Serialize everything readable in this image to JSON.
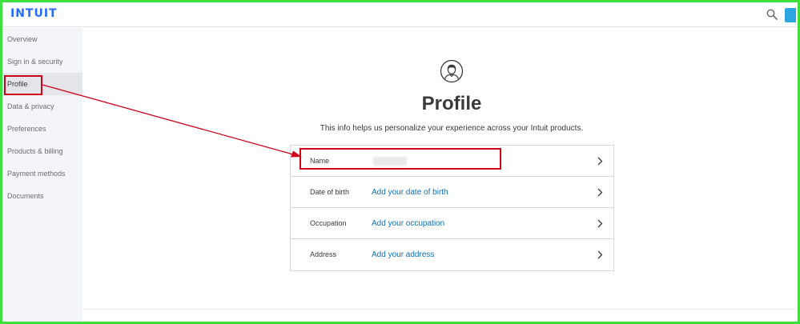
{
  "app": {
    "logo": "INTUIT"
  },
  "header": {
    "search_icon": "search-icon",
    "avatar_icon": "avatar-icon"
  },
  "sidebar": {
    "items": [
      {
        "label": "Overview"
      },
      {
        "label": "Sign in & security"
      },
      {
        "label": "Profile",
        "active": true
      },
      {
        "label": "Data & privacy"
      },
      {
        "label": "Preferences"
      },
      {
        "label": "Products & billing"
      },
      {
        "label": "Payment methods"
      },
      {
        "label": "Documents"
      }
    ]
  },
  "main": {
    "icon": "user-profile-icon",
    "title": "Profile",
    "subtitle": "This info helps us personalize your experience across your Intuit products.",
    "rows": [
      {
        "label": "Name",
        "value": ""
      },
      {
        "label": "Date of birth",
        "value": "Add your date of birth"
      },
      {
        "label": "Occupation",
        "value": "Add your occupation"
      },
      {
        "label": "Address",
        "value": "Add your address"
      }
    ]
  },
  "colors": {
    "brand": "#236cff",
    "link": "#0d70b8",
    "annotation": "#d0021b",
    "frame": "#3ee03e",
    "sidebar_bg": "#f4f5f8"
  }
}
